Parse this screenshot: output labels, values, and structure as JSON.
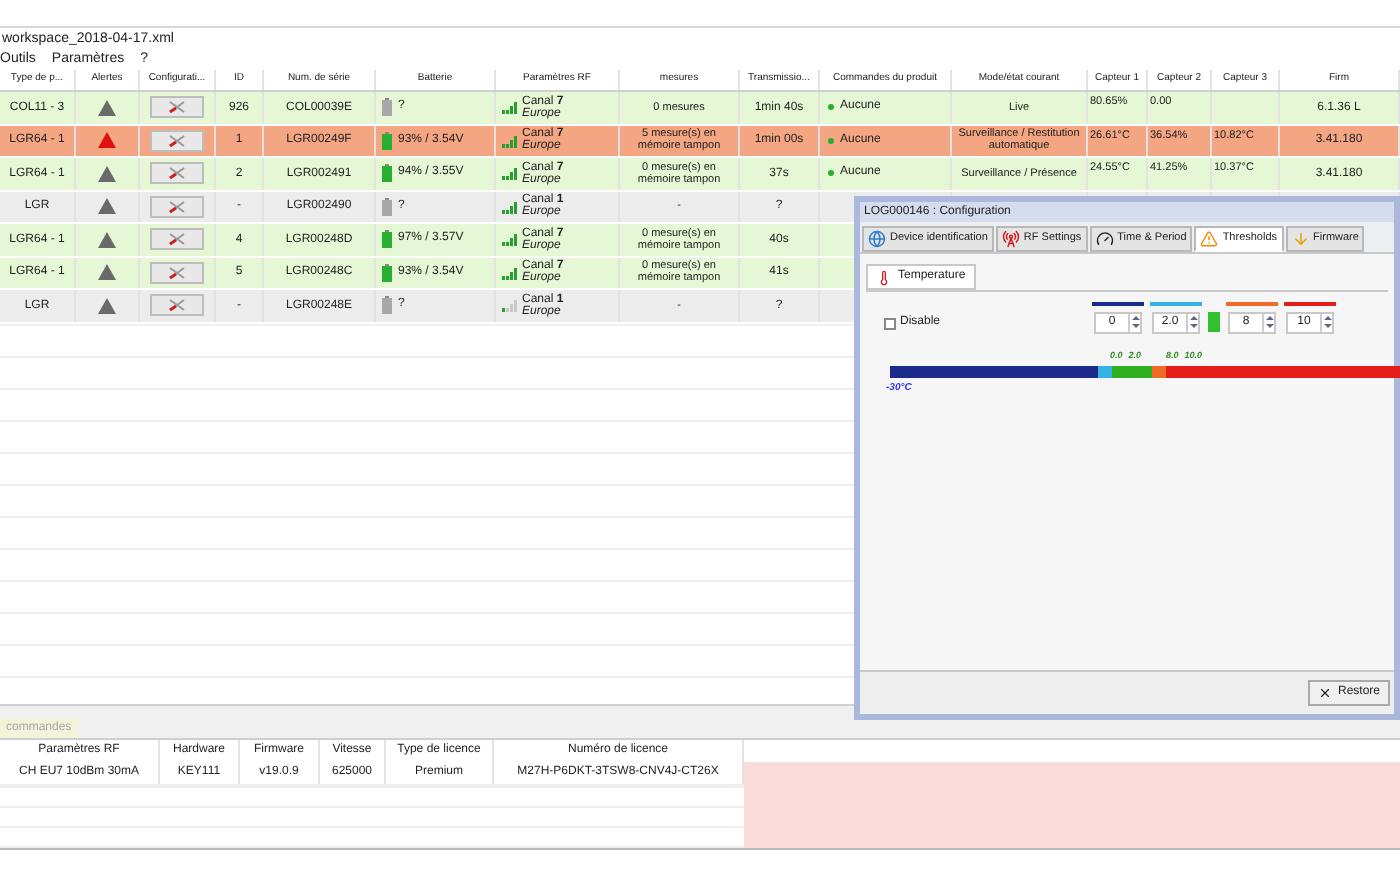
{
  "window": {
    "title": "workspace_2018-04-17.xml"
  },
  "menu": [
    "Outils",
    "Paramètres",
    "?"
  ],
  "table": {
    "columns": [
      "Type de p...",
      "Alertes",
      "Configurati...",
      "ID",
      "Num. de série",
      "Batterie",
      "Paramètres RF",
      "mesures",
      "Transmissio...",
      "Commandes du produit",
      "Mode/état courant",
      "Capteur 1",
      "Capteur 2",
      "Capteur 3",
      "Firm"
    ],
    "rows": [
      {
        "kind": "ok",
        "type": "COL11 - 3",
        "alert": false,
        "id": "926",
        "serial": "COL00039E",
        "battery_known": false,
        "battery": "?",
        "canal": "Canal **7**",
        "region": "Europe",
        "signal_active": true,
        "mesures": "0 mesures",
        "transmission": "1min 40s",
        "commandes": "Aucune",
        "mode": "Live",
        "c1": "80.65%",
        "c2": "0.00",
        "c3": "",
        "firmware": "6.1.36 L"
      },
      {
        "kind": "alert",
        "type": "LGR64 - 1",
        "alert": true,
        "id": "1",
        "serial": "LGR00249F",
        "battery_known": true,
        "battery": "93% / 3.54V",
        "canal": "Canal **7**",
        "region": "Europe",
        "signal_active": true,
        "mesures": "5 mesure(s) en mémoire tampon",
        "transmission": "1min 00s",
        "commandes": "Aucune",
        "mode": "Surveillance / Restitution automatique",
        "c1": "26.61°C",
        "c2": "36.54%",
        "c3": "10.82°C",
        "firmware": "3.41.180"
      },
      {
        "kind": "ok",
        "type": "LGR64 - 1",
        "alert": false,
        "id": "2",
        "serial": "LGR002491",
        "battery_known": true,
        "battery": "94% / 3.55V",
        "canal": "Canal **7**",
        "region": "Europe",
        "signal_active": true,
        "mesures": "0 mesure(s) en mémoire tampon",
        "transmission": "37s",
        "commandes": "Aucune",
        "mode": "Surveillance / Présence",
        "c1": "24.55°C",
        "c2": "41.25%",
        "c3": "10.37°C",
        "firmware": "3.41.180"
      },
      {
        "kind": "inactive",
        "type": "LGR",
        "alert": false,
        "id": "-",
        "serial": "LGR002490",
        "battery_known": false,
        "battery": "?",
        "canal": "Canal **1**",
        "region": "Europe",
        "signal_active": true,
        "mesures": "-",
        "transmission": "?"
      },
      {
        "kind": "ok",
        "type": "LGR64 - 1",
        "alert": false,
        "id": "4",
        "serial": "LGR00248D",
        "battery_known": true,
        "battery": "97% / 3.57V",
        "canal": "Canal **7**",
        "region": "Europe",
        "signal_active": true,
        "mesures": "0 mesure(s) en mémoire tampon",
        "transmission": "40s"
      },
      {
        "kind": "ok",
        "type": "LGR64 - 1",
        "alert": false,
        "id": "5",
        "serial": "LGR00248C",
        "battery_known": true,
        "battery": "93% / 3.54V",
        "canal": "Canal **7**",
        "region": "Europe",
        "signal_active": true,
        "mesures": "0 mesure(s) en mémoire tampon",
        "transmission": "41s"
      },
      {
        "kind": "inactive",
        "type": "LGR",
        "alert": false,
        "id": "-",
        "serial": "LGR00248E",
        "battery_known": false,
        "battery": "?",
        "canal": "Canal **1**",
        "region": "Europe",
        "signal_active": false,
        "mesures": "-",
        "transmission": "?"
      }
    ]
  },
  "dialog": {
    "title": "LOG000146 : Configuration",
    "tabs": [
      {
        "label": "Device identification",
        "selected": false
      },
      {
        "label": "RF Settings",
        "selected": false
      },
      {
        "label": "Time & Period",
        "selected": false
      },
      {
        "label": "Thresholds",
        "selected": true
      },
      {
        "label": "Firmware",
        "selected": false
      }
    ],
    "subtab": {
      "label": "Temperature",
      "selected": true
    },
    "disable": {
      "label": "Disable",
      "checked": false
    },
    "thresholds": [
      {
        "value": "0",
        "color": "#1c2a8c"
      },
      {
        "value": "2.0",
        "color": "#34b4e4"
      },
      {
        "value": "8",
        "color": "#f06a28"
      },
      {
        "value": "10",
        "color": "#e41c1c"
      }
    ],
    "markers": [
      "0.0",
      "2.0",
      "8.0",
      "10.0"
    ],
    "scale_min": "-30°C",
    "restore_button": "Restore"
  },
  "bottom_tab": "commandes",
  "details": {
    "columns": [
      "Paramètres RF",
      "Hardware",
      "Firmware",
      "Vitesse",
      "Type de licence",
      "Numéro de licence"
    ],
    "row": [
      "CH EU7  10dBm 30mA",
      "KEY111",
      "v19.0.9",
      "625000",
      "Premium",
      "M27H-P6DKT-3TSW8-CNV4J-CT26X"
    ]
  }
}
